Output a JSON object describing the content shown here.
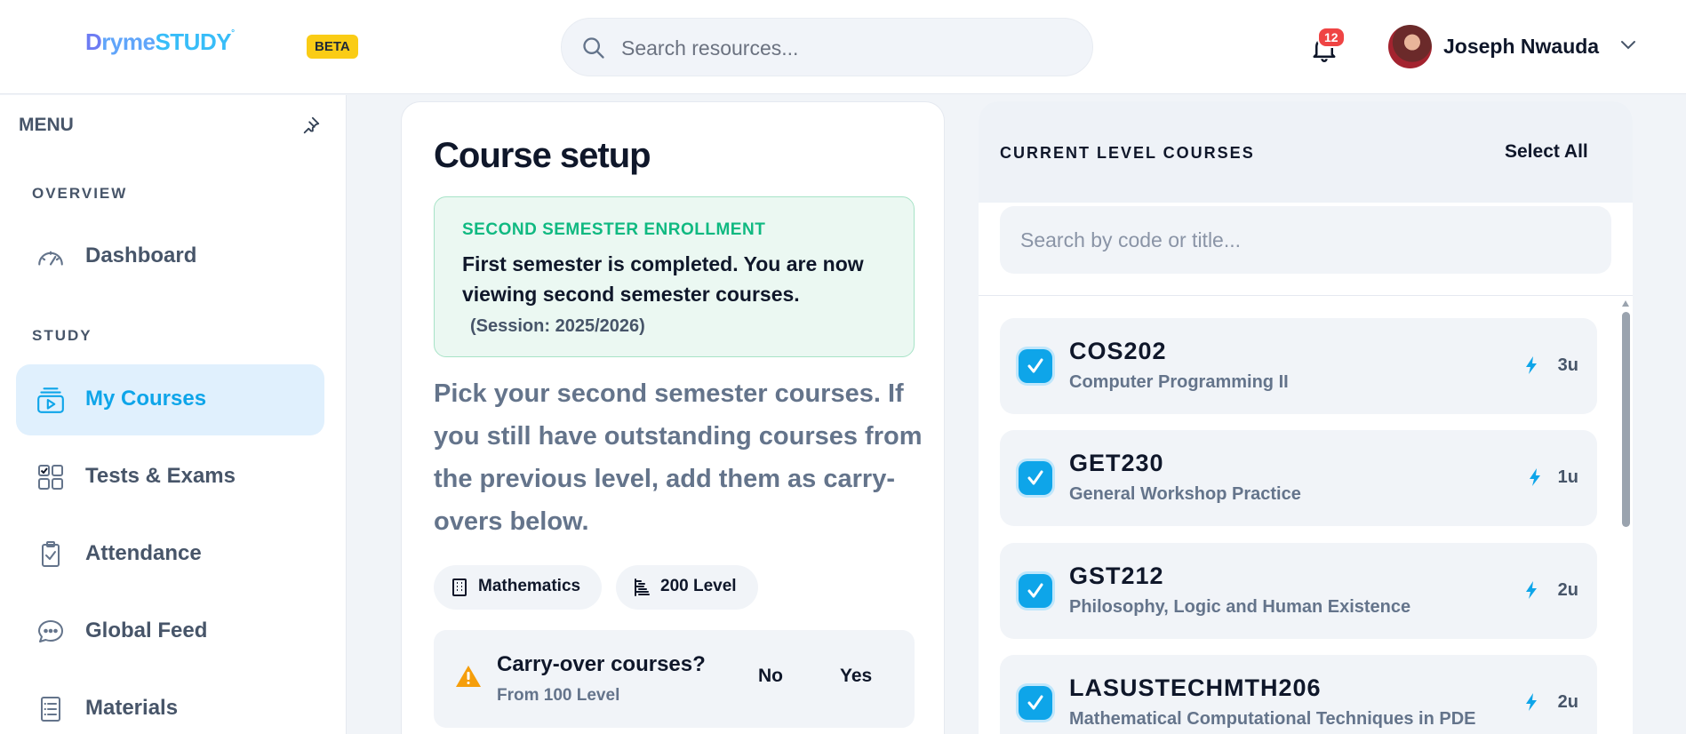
{
  "header": {
    "logo_part1": "D",
    "logo_part2": "ryme",
    "logo_part3": "STUDY",
    "beta_label": "BETA",
    "search_placeholder": "Search resources...",
    "notification_count": "12",
    "user_name": "Joseph Nwauda"
  },
  "sidebar": {
    "menu_label": "MENU",
    "sections": {
      "overview": "OVERVIEW",
      "study": "STUDY"
    },
    "items": [
      {
        "label": "Dashboard",
        "icon": "gauge-icon",
        "active": false
      },
      {
        "label": "My Courses",
        "icon": "video-layers-icon",
        "active": true
      },
      {
        "label": "Tests & Exams",
        "icon": "grid-check-icon",
        "active": false
      },
      {
        "label": "Attendance",
        "icon": "clipboard-check-icon",
        "active": false
      },
      {
        "label": "Global Feed",
        "icon": "chat-bubble-icon",
        "active": false
      },
      {
        "label": "Materials",
        "icon": "list-document-icon",
        "active": false
      }
    ]
  },
  "setup": {
    "title": "Course setup",
    "enrollment": {
      "title": "SECOND SEMESTER ENROLLMENT",
      "text": "First semester is completed. You are now viewing second semester courses.",
      "session": "(Session: 2025/2026)"
    },
    "instructions": "Pick your second semester courses. If you still have outstanding courses from the previous level, add them as carry-overs below.",
    "chips": {
      "department": "Mathematics",
      "level": "200 Level"
    },
    "carryover": {
      "title": "Carry-over courses?",
      "subtitle": "From 100 Level",
      "no_label": "No",
      "yes_label": "Yes"
    }
  },
  "courses_panel": {
    "title": "CURRENT LEVEL COURSES",
    "select_all": "Select All",
    "search_placeholder": "Search by code or title...",
    "courses": [
      {
        "code": "COS202",
        "title": "Computer Programming II",
        "units": "3u",
        "checked": true
      },
      {
        "code": "GET230",
        "title": "General Workshop Practice",
        "units": "1u",
        "checked": true
      },
      {
        "code": "GST212",
        "title": "Philosophy, Logic and Human Existence",
        "units": "2u",
        "checked": true
      },
      {
        "code": "LASUSTECHMTH206",
        "title": "Mathematical Computational Techniques in PDE",
        "units": "2u",
        "checked": true
      }
    ]
  },
  "colors": {
    "accent": "#0ea5e9",
    "success": "#10b981",
    "warning": "#f59e0b",
    "badge": "#ef4444",
    "beta": "#facc15"
  }
}
